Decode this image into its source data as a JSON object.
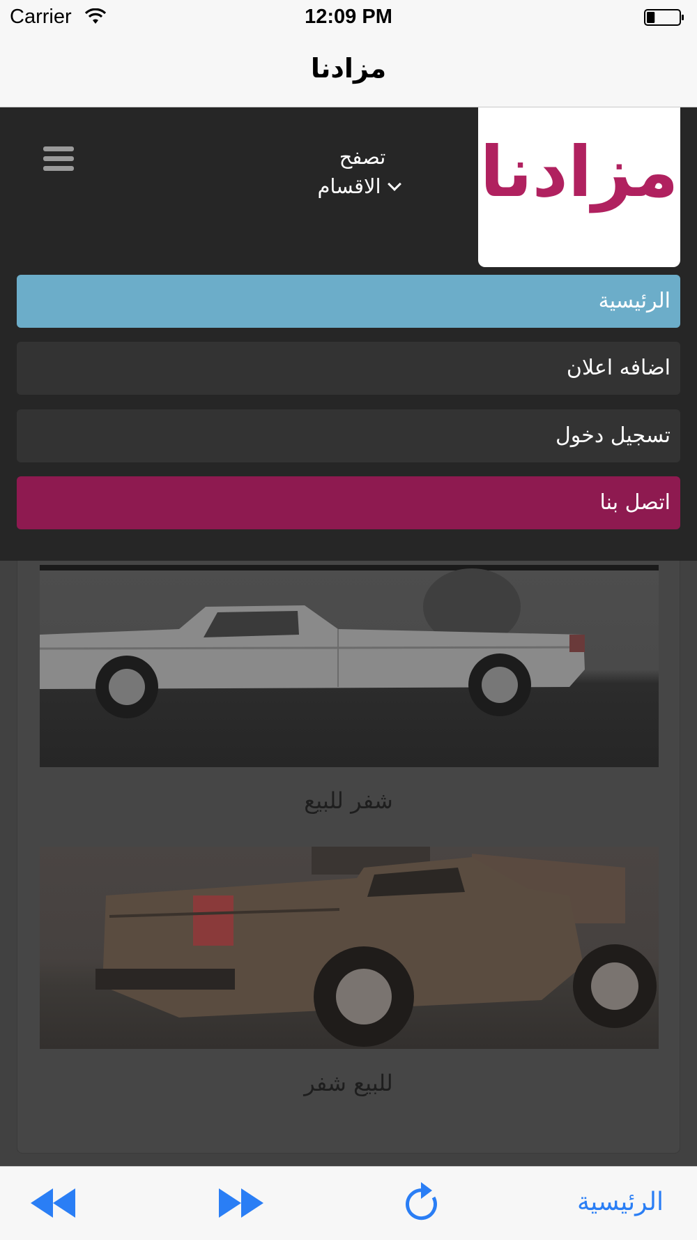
{
  "status_bar": {
    "carrier": "Carrier",
    "time": "12:09 PM",
    "battery_level": 0.25
  },
  "navbar": {
    "title": "مزادنا"
  },
  "header": {
    "logo_text": "مزادنا",
    "logo_color": "#b0215f",
    "browse_line1": "تصفح",
    "browse_line2": "الاقسام"
  },
  "menu": {
    "items": [
      {
        "label": "الرئيسية",
        "color": "#6cadc9"
      },
      {
        "label": "اضافه اعلان",
        "color": "#333333"
      },
      {
        "label": "تسجيل دخول",
        "color": "#333333"
      },
      {
        "label": "اتصل بنا",
        "color": "#8e1a50"
      }
    ]
  },
  "listings": [
    {
      "title": "شفر للبيع"
    },
    {
      "title": "للبيع شفر"
    }
  ],
  "toolbar": {
    "back_icon": "rewind-icon",
    "forward_icon": "fast-forward-icon",
    "reload_icon": "reload-icon",
    "home_label": "الرئيسية",
    "accent": "#2a7ef5"
  }
}
